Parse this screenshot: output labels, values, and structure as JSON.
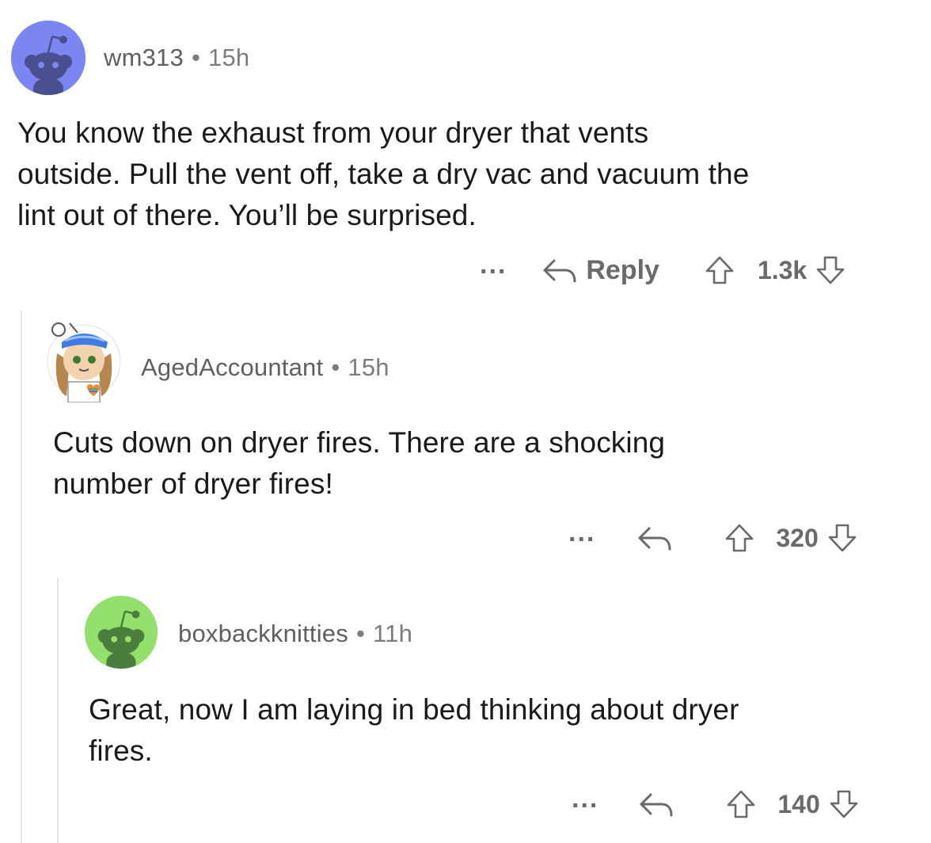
{
  "comments": [
    {
      "username": "wm313",
      "time": "15h",
      "separator": "•",
      "body_lines": [
        "You know the exhaust from your dryer that vents",
        "outside. Pull the vent off, take a dry vac and vacuum the",
        "lint out of there. You’ll be surprised."
      ],
      "more_label": "...",
      "reply_label": "Reply",
      "score": "1.3k",
      "avatar_color": "#7c86f2"
    },
    {
      "username": "AgedAccountant",
      "time": "15h",
      "separator": "•",
      "body_lines": [
        "Cuts down on dryer fires.  There are a shocking",
        "number of dryer fires!"
      ],
      "more_label": "...",
      "score": "320",
      "avatar_color": "#ffffff"
    },
    {
      "username": "boxbackknitties",
      "time": "11h",
      "separator": "•",
      "body_lines": [
        "Great, now I am laying in bed thinking about dryer",
        "fires."
      ],
      "more_label": "...",
      "score": "140",
      "avatar_color": "#94e06c"
    }
  ],
  "colors": {
    "text": "#1a1a1b",
    "meta": "#7c7c7c",
    "action": "#6a6a6a",
    "thread_line": "#e6e6e6"
  },
  "icons": [
    "snoo-avatar-icon",
    "reply-arrow-icon",
    "upvote-arrow-icon",
    "downvote-arrow-icon",
    "more-options-icon"
  ]
}
